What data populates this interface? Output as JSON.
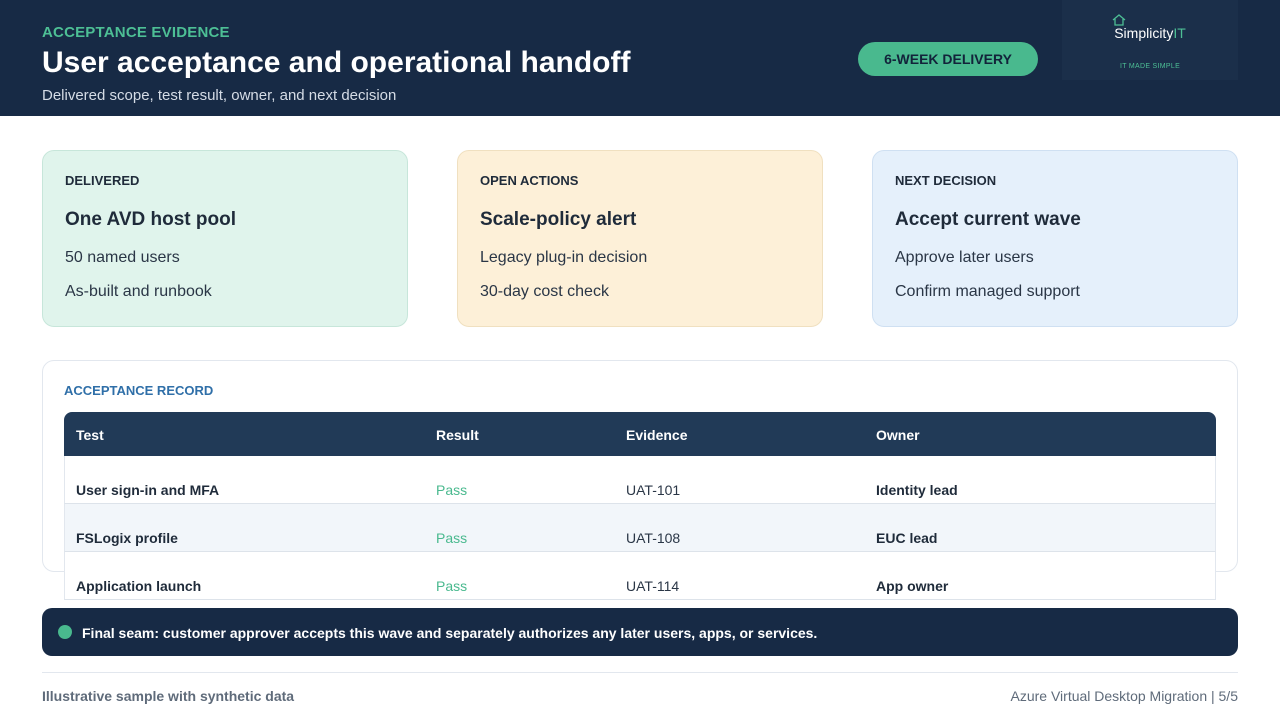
{
  "header": {
    "eyebrow": "ACCEPTANCE EVIDENCE",
    "title": "User acceptance and operational handoff",
    "subtitle": "Delivered scope, test result, owner, and next decision",
    "badge": "6-WEEK DELIVERY",
    "logo": {
      "word_main": "Simplicity",
      "word_accent": "IT",
      "tagline": "IT MADE SIMPLE",
      "icon": "house-icon"
    }
  },
  "cards": [
    {
      "label": "DELIVERED",
      "headline": "One AVD host pool",
      "line1": "50 named users",
      "line2": "As-built and runbook"
    },
    {
      "label": "OPEN ACTIONS",
      "headline": "Scale-policy alert",
      "line1": "Legacy plug-in decision",
      "line2": "30-day cost check"
    },
    {
      "label": "NEXT DECISION",
      "headline": "Accept current wave",
      "line1": "Approve later users",
      "line2": "Confirm managed support"
    }
  ],
  "record": {
    "label": "ACCEPTANCE RECORD",
    "columns": [
      "Test",
      "Result",
      "Evidence",
      "Owner"
    ],
    "rows": [
      {
        "test": "User sign-in and MFA",
        "result": "Pass",
        "evidence": "UAT-101",
        "owner": "Identity lead"
      },
      {
        "test": "FSLogix profile",
        "result": "Pass",
        "evidence": "UAT-108",
        "owner": "EUC lead"
      },
      {
        "test": "Application launch",
        "result": "Pass",
        "evidence": "UAT-114",
        "owner": "App owner"
      }
    ]
  },
  "seam": {
    "text": "Final seam: customer approver accepts this wave and separately authorizes any later users, apps, or services."
  },
  "footer": {
    "left": "Illustrative sample with synthetic data",
    "right": "Azure Virtual Desktop Migration | 5/5"
  },
  "colors": {
    "navy": "#172a45",
    "accent_green": "#49b98e",
    "delivered_bg": "#e0f4ec",
    "open_bg": "#fdf0d8",
    "next_bg": "#e5f0fb"
  }
}
